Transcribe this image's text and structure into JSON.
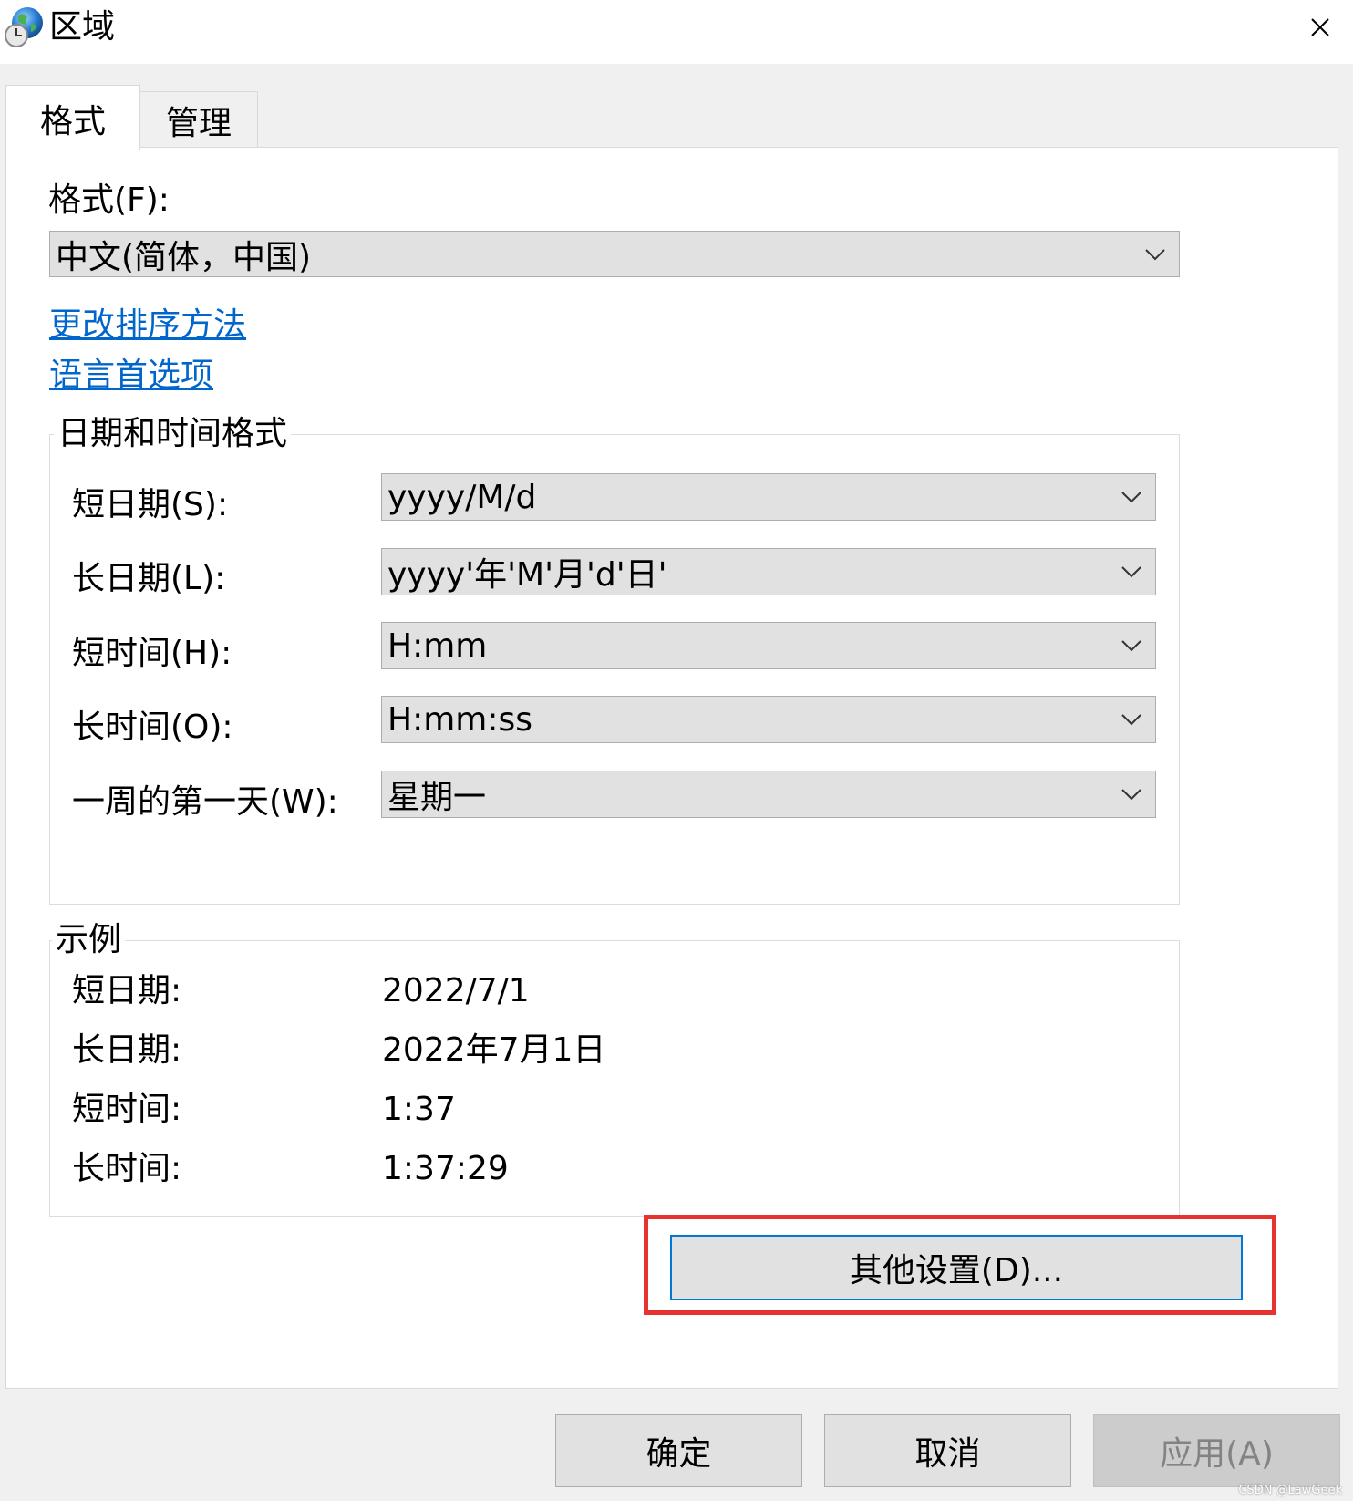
{
  "window": {
    "title": "区域",
    "close_glyph": "✕"
  },
  "tabs": [
    {
      "label": "格式",
      "active": true
    },
    {
      "label": "管理",
      "active": false
    }
  ],
  "format": {
    "label": "格式(F):",
    "value": "中文(简体，中国)"
  },
  "links": {
    "change_sort": "更改排序方法",
    "language_prefs": "语言首选项"
  },
  "datetime": {
    "group_title": "日期和时间格式",
    "rows": [
      {
        "label": "短日期(S):",
        "value": "yyyy/M/d"
      },
      {
        "label": "长日期(L):",
        "value": "yyyy'年'M'月'd'日'"
      },
      {
        "label": "短时间(H):",
        "value": "H:mm"
      },
      {
        "label": "长时间(O):",
        "value": "H:mm:ss"
      },
      {
        "label": "一周的第一天(W):",
        "value": "星期一"
      }
    ]
  },
  "examples": {
    "group_title": "示例",
    "rows": [
      {
        "label": "短日期:",
        "value": "2022/7/1"
      },
      {
        "label": "长日期:",
        "value": "2022年7月1日"
      },
      {
        "label": "短时间:",
        "value": "1:37"
      },
      {
        "label": "长时间:",
        "value": "1:37:29"
      }
    ]
  },
  "buttons": {
    "other_settings": "其他设置(D)...",
    "ok": "确定",
    "cancel": "取消",
    "apply": "应用(A)"
  },
  "watermark": "CSDN @LawGeek",
  "colors": {
    "link": "#0066cc",
    "focus_border": "#0078d7",
    "highlight": "#e8322f"
  },
  "icons": {
    "app": "globe-clock-icon",
    "close": "close-icon",
    "dropdown": "chevron-down-icon"
  }
}
